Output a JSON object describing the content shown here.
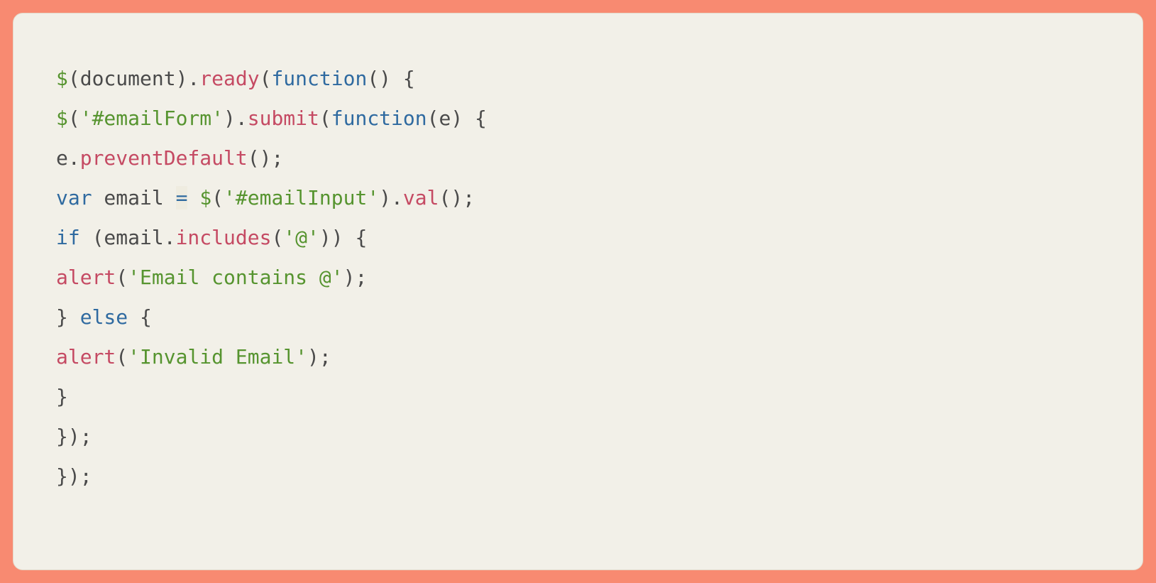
{
  "code": {
    "lines": [
      [
        {
          "t": "$",
          "c": "green"
        },
        {
          "t": "(",
          "c": "default"
        },
        {
          "t": "document",
          "c": "default"
        },
        {
          "t": ").",
          "c": "default"
        },
        {
          "t": "ready",
          "c": "crimson"
        },
        {
          "t": "(",
          "c": "default"
        },
        {
          "t": "function",
          "c": "blue"
        },
        {
          "t": "() {",
          "c": "default"
        }
      ],
      [
        {
          "t": "$",
          "c": "green"
        },
        {
          "t": "(",
          "c": "default"
        },
        {
          "t": "'#emailForm'",
          "c": "green"
        },
        {
          "t": ").",
          "c": "default"
        },
        {
          "t": "submit",
          "c": "crimson"
        },
        {
          "t": "(",
          "c": "default"
        },
        {
          "t": "function",
          "c": "blue"
        },
        {
          "t": "(e) {",
          "c": "default"
        }
      ],
      [
        {
          "t": "e.",
          "c": "default"
        },
        {
          "t": "preventDefault",
          "c": "crimson"
        },
        {
          "t": "();",
          "c": "default"
        }
      ],
      [
        {
          "t": "var",
          "c": "blue"
        },
        {
          "t": " email ",
          "c": "default"
        },
        {
          "t": "=",
          "c": "keyword"
        },
        {
          "t": " ",
          "c": "default"
        },
        {
          "t": "$",
          "c": "green"
        },
        {
          "t": "(",
          "c": "default"
        },
        {
          "t": "'#emailInput'",
          "c": "green"
        },
        {
          "t": ").",
          "c": "default"
        },
        {
          "t": "val",
          "c": "crimson"
        },
        {
          "t": "();",
          "c": "default"
        }
      ],
      [
        {
          "t": "if",
          "c": "blue"
        },
        {
          "t": " (email.",
          "c": "default"
        },
        {
          "t": "includes",
          "c": "crimson"
        },
        {
          "t": "(",
          "c": "default"
        },
        {
          "t": "'@'",
          "c": "green"
        },
        {
          "t": ")) {",
          "c": "default"
        }
      ],
      [
        {
          "t": "alert",
          "c": "crimson"
        },
        {
          "t": "(",
          "c": "default"
        },
        {
          "t": "'Email contains @'",
          "c": "green"
        },
        {
          "t": ");",
          "c": "default"
        }
      ],
      [
        {
          "t": "} ",
          "c": "default"
        },
        {
          "t": "else",
          "c": "blue"
        },
        {
          "t": " {",
          "c": "default"
        }
      ],
      [
        {
          "t": "alert",
          "c": "crimson"
        },
        {
          "t": "(",
          "c": "default"
        },
        {
          "t": "'Invalid Email'",
          "c": "green"
        },
        {
          "t": ");",
          "c": "default"
        }
      ],
      [
        {
          "t": "}",
          "c": "default"
        }
      ],
      [
        {
          "t": "});",
          "c": "default"
        }
      ],
      [
        {
          "t": "});",
          "c": "default"
        }
      ]
    ]
  }
}
